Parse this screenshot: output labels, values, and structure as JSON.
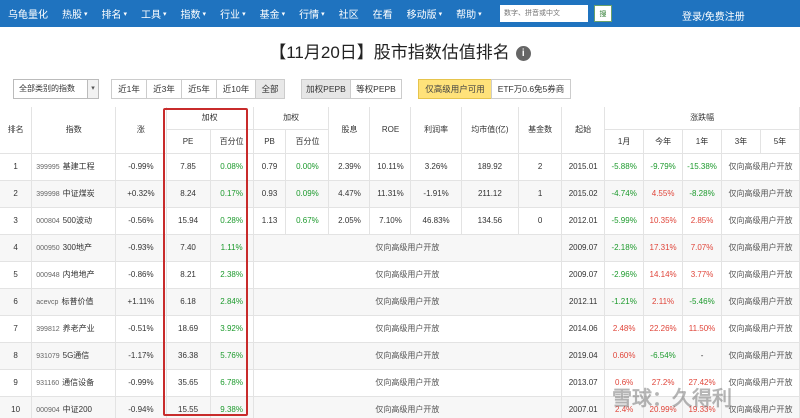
{
  "nav": {
    "logo": "乌龟量化",
    "items": [
      {
        "label": "热股",
        "caret": true
      },
      {
        "label": "排名",
        "caret": true
      },
      {
        "label": "工具",
        "caret": true
      },
      {
        "label": "指数",
        "caret": true
      },
      {
        "label": "行业",
        "caret": true
      },
      {
        "label": "基金",
        "caret": true
      },
      {
        "label": "行情",
        "caret": true
      },
      {
        "label": "社区",
        "caret": false
      },
      {
        "label": "在看",
        "caret": false
      },
      {
        "label": "移动版",
        "caret": true
      },
      {
        "label": "帮助",
        "caret": true
      }
    ],
    "search_placeholder": "数字、拼音或中文",
    "search_button": "搜",
    "login": "登录/免费注册"
  },
  "title": "【11月20日】股市指数估值排名",
  "filters": {
    "category_select": "全部类别的指数",
    "periods": [
      "近1年",
      "近3年",
      "近5年",
      "近10年",
      "全部"
    ],
    "active_period": "全部",
    "weight_modes": [
      "加权PEPB",
      "等权PEPB"
    ],
    "active_weight": "加权PEPB",
    "premium_badge": "仅高级用户可用",
    "etf_promo": "ETF万0.6免5券商"
  },
  "table": {
    "headers": {
      "rank": "排名",
      "index": "指数",
      "change": "涨",
      "weighted_pe": "加权",
      "weighted_pb": "加权",
      "pe": "PE",
      "pe_pct": "百分位",
      "pb": "PB",
      "pb_pct": "百分位",
      "dividend": "股息",
      "roe": "ROE",
      "margin": "利润率",
      "market_cap": "均市值(亿)",
      "funds": "基金数",
      "start": "起始",
      "returns": "涨跌幅",
      "m1": "1月",
      "ytd": "今年",
      "y1": "1年",
      "y3": "3年",
      "y5": "5年"
    },
    "locked_text": "仅向高级用户开放",
    "rows": [
      {
        "rank": "1",
        "code": "399995",
        "name": "基建工程",
        "change": "-0.99%",
        "pe": "7.85",
        "pe_pct": "0.08%",
        "pb": "0.79",
        "pb_pct": "0.00%",
        "dividend": "2.39%",
        "roe": "10.11%",
        "margin": "3.26%",
        "cap": "189.92",
        "funds": "2",
        "start": "2015.01",
        "m1": "-5.88%",
        "ytd": "-9.79%",
        "y1": "-15.38%",
        "locked": false
      },
      {
        "rank": "2",
        "code": "399998",
        "name": "中证煤炭",
        "change": "+0.32%",
        "pe": "8.24",
        "pe_pct": "0.17%",
        "pb": "0.93",
        "pb_pct": "0.09%",
        "dividend": "4.47%",
        "roe": "11.31%",
        "margin": "-1.91%",
        "cap": "211.12",
        "funds": "1",
        "start": "2015.02",
        "m1": "-4.74%",
        "ytd": "4.55%",
        "y1": "-8.28%",
        "locked": false
      },
      {
        "rank": "3",
        "code": "000804",
        "name": "500波动",
        "change": "-0.56%",
        "pe": "15.94",
        "pe_pct": "0.28%",
        "pb": "1.13",
        "pb_pct": "0.67%",
        "dividend": "2.05%",
        "roe": "7.10%",
        "margin": "46.83%",
        "cap": "134.56",
        "funds": "0",
        "start": "2012.01",
        "m1": "-5.99%",
        "ytd": "10.35%",
        "y1": "2.85%",
        "locked": false
      },
      {
        "rank": "4",
        "code": "000950",
        "name": "300地产",
        "change": "-0.93%",
        "pe": "7.40",
        "pe_pct": "1.11%",
        "start": "2009.07",
        "m1": "-2.18%",
        "ytd": "17.31%",
        "y1": "7.07%",
        "locked": true
      },
      {
        "rank": "5",
        "code": "000948",
        "name": "内地地产",
        "change": "-0.86%",
        "pe": "8.21",
        "pe_pct": "2.38%",
        "start": "2009.07",
        "m1": "-2.96%",
        "ytd": "14.14%",
        "y1": "3.77%",
        "locked": true
      },
      {
        "rank": "6",
        "code": "acevcp",
        "name": "标普价值",
        "change": "+1.11%",
        "pe": "6.18",
        "pe_pct": "2.84%",
        "start": "2012.11",
        "m1": "-1.21%",
        "ytd": "2.11%",
        "y1": "-5.46%",
        "locked": true
      },
      {
        "rank": "7",
        "code": "399812",
        "name": "养老产业",
        "change": "-0.51%",
        "pe": "18.69",
        "pe_pct": "3.92%",
        "start": "2014.06",
        "m1": "2.48%",
        "ytd": "22.26%",
        "y1": "11.50%",
        "locked": true
      },
      {
        "rank": "8",
        "code": "931079",
        "name": "5G通信",
        "change": "-1.17%",
        "pe": "36.38",
        "pe_pct": "5.76%",
        "start": "2019.04",
        "m1": "0.60%",
        "ytd": "-6.54%",
        "y1": "-",
        "locked": true
      },
      {
        "rank": "9",
        "code": "931160",
        "name": "通信设备",
        "change": "-0.99%",
        "pe": "35.65",
        "pe_pct": "6.78%",
        "start": "2013.07",
        "m1": "0.6%",
        "ytd": "27.2%",
        "y1": "27.42%",
        "locked": true
      },
      {
        "rank": "10",
        "code": "000904",
        "name": "中证200",
        "change": "-0.94%",
        "pe": "15.55",
        "pe_pct": "9.38%",
        "start": "2007.01",
        "m1": "2.4%",
        "ytd": "20.99%",
        "y1": "19.33%",
        "locked": true
      }
    ]
  },
  "watermark": "雪球：久得利"
}
